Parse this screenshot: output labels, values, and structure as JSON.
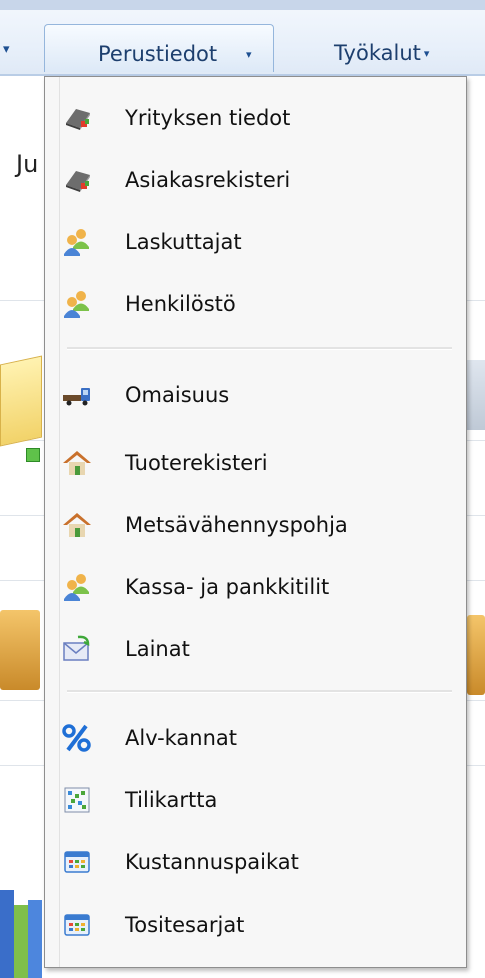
{
  "menubar": {
    "left_caret": "▾",
    "active_menu_label": "Perustiedot",
    "active_menu_caret": "▾",
    "tools_menu_label": "Työkalut",
    "tools_menu_caret": "▾"
  },
  "background": {
    "partial_text": "Ju"
  },
  "dropdown": {
    "groups": [
      [
        {
          "label": "Yrityksen tiedot",
          "icon": "book-icon"
        },
        {
          "label": "Asiakasrekisteri",
          "icon": "book-icon"
        },
        {
          "label": "Laskuttajat",
          "icon": "users-icon"
        },
        {
          "label": "Henkilöstö",
          "icon": "users-icon"
        }
      ],
      [
        {
          "label": "Omaisuus",
          "icon": "truck-icon"
        },
        {
          "label": "Tuoterekisteri",
          "icon": "house-icon"
        },
        {
          "label": "Metsävähennyspohja",
          "icon": "house-icon"
        },
        {
          "label": "Kassa- ja pankkitilit",
          "icon": "users-icon"
        },
        {
          "label": "Lainat",
          "icon": "mail-icon"
        }
      ],
      [
        {
          "label": "Alv-kannat",
          "icon": "percent-icon"
        },
        {
          "label": "Tilikartta",
          "icon": "chart-grid-icon"
        },
        {
          "label": "Kustannuspaikat",
          "icon": "table-icon"
        },
        {
          "label": "Tositesarjat",
          "icon": "table-icon"
        }
      ]
    ]
  }
}
